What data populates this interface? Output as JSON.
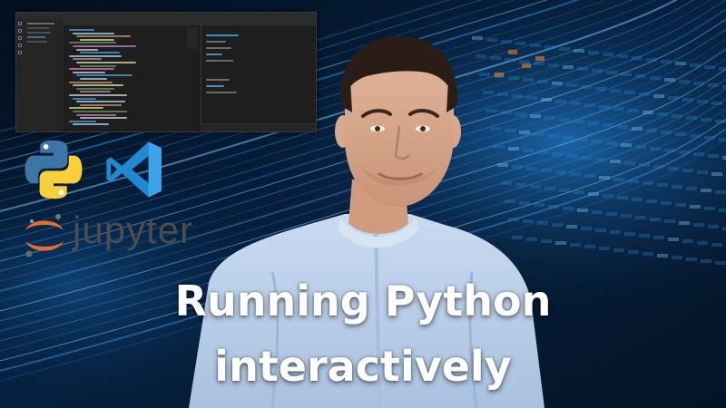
{
  "title": {
    "line1": "Running Python",
    "line2": "interactively"
  },
  "logos": {
    "python": "python-logo-icon",
    "vscode": "vscode-logo-icon",
    "jupyter_text": "jupyter"
  },
  "colors": {
    "python_blue": "#3d75a6",
    "python_yellow": "#f7d03c",
    "vscode_blue": "#1f8ad2",
    "jupyter_orange": "#e46e2e",
    "jupyter_gray": "#4a4c50",
    "background": "#04101e",
    "title_text": "#ffffff"
  }
}
